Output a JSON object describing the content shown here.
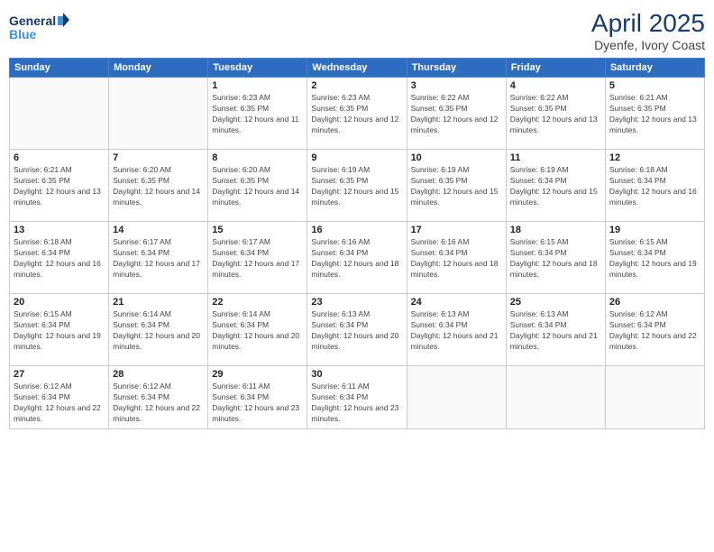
{
  "logo": {
    "line1": "General",
    "line2": "Blue"
  },
  "title": "April 2025",
  "subtitle": "Dyenfe, Ivory Coast",
  "days_of_week": [
    "Sunday",
    "Monday",
    "Tuesday",
    "Wednesday",
    "Thursday",
    "Friday",
    "Saturday"
  ],
  "weeks": [
    [
      {
        "day": "",
        "info": ""
      },
      {
        "day": "",
        "info": ""
      },
      {
        "day": "1",
        "info": "Sunrise: 6:23 AM\nSunset: 6:35 PM\nDaylight: 12 hours and 11 minutes."
      },
      {
        "day": "2",
        "info": "Sunrise: 6:23 AM\nSunset: 6:35 PM\nDaylight: 12 hours and 12 minutes."
      },
      {
        "day": "3",
        "info": "Sunrise: 6:22 AM\nSunset: 6:35 PM\nDaylight: 12 hours and 12 minutes."
      },
      {
        "day": "4",
        "info": "Sunrise: 6:22 AM\nSunset: 6:35 PM\nDaylight: 12 hours and 13 minutes."
      },
      {
        "day": "5",
        "info": "Sunrise: 6:21 AM\nSunset: 6:35 PM\nDaylight: 12 hours and 13 minutes."
      }
    ],
    [
      {
        "day": "6",
        "info": "Sunrise: 6:21 AM\nSunset: 6:35 PM\nDaylight: 12 hours and 13 minutes."
      },
      {
        "day": "7",
        "info": "Sunrise: 6:20 AM\nSunset: 6:35 PM\nDaylight: 12 hours and 14 minutes."
      },
      {
        "day": "8",
        "info": "Sunrise: 6:20 AM\nSunset: 6:35 PM\nDaylight: 12 hours and 14 minutes."
      },
      {
        "day": "9",
        "info": "Sunrise: 6:19 AM\nSunset: 6:35 PM\nDaylight: 12 hours and 15 minutes."
      },
      {
        "day": "10",
        "info": "Sunrise: 6:19 AM\nSunset: 6:35 PM\nDaylight: 12 hours and 15 minutes."
      },
      {
        "day": "11",
        "info": "Sunrise: 6:19 AM\nSunset: 6:34 PM\nDaylight: 12 hours and 15 minutes."
      },
      {
        "day": "12",
        "info": "Sunrise: 6:18 AM\nSunset: 6:34 PM\nDaylight: 12 hours and 16 minutes."
      }
    ],
    [
      {
        "day": "13",
        "info": "Sunrise: 6:18 AM\nSunset: 6:34 PM\nDaylight: 12 hours and 16 minutes."
      },
      {
        "day": "14",
        "info": "Sunrise: 6:17 AM\nSunset: 6:34 PM\nDaylight: 12 hours and 17 minutes."
      },
      {
        "day": "15",
        "info": "Sunrise: 6:17 AM\nSunset: 6:34 PM\nDaylight: 12 hours and 17 minutes."
      },
      {
        "day": "16",
        "info": "Sunrise: 6:16 AM\nSunset: 6:34 PM\nDaylight: 12 hours and 18 minutes."
      },
      {
        "day": "17",
        "info": "Sunrise: 6:16 AM\nSunset: 6:34 PM\nDaylight: 12 hours and 18 minutes."
      },
      {
        "day": "18",
        "info": "Sunrise: 6:15 AM\nSunset: 6:34 PM\nDaylight: 12 hours and 18 minutes."
      },
      {
        "day": "19",
        "info": "Sunrise: 6:15 AM\nSunset: 6:34 PM\nDaylight: 12 hours and 19 minutes."
      }
    ],
    [
      {
        "day": "20",
        "info": "Sunrise: 6:15 AM\nSunset: 6:34 PM\nDaylight: 12 hours and 19 minutes."
      },
      {
        "day": "21",
        "info": "Sunrise: 6:14 AM\nSunset: 6:34 PM\nDaylight: 12 hours and 20 minutes."
      },
      {
        "day": "22",
        "info": "Sunrise: 6:14 AM\nSunset: 6:34 PM\nDaylight: 12 hours and 20 minutes."
      },
      {
        "day": "23",
        "info": "Sunrise: 6:13 AM\nSunset: 6:34 PM\nDaylight: 12 hours and 20 minutes."
      },
      {
        "day": "24",
        "info": "Sunrise: 6:13 AM\nSunset: 6:34 PM\nDaylight: 12 hours and 21 minutes."
      },
      {
        "day": "25",
        "info": "Sunrise: 6:13 AM\nSunset: 6:34 PM\nDaylight: 12 hours and 21 minutes."
      },
      {
        "day": "26",
        "info": "Sunrise: 6:12 AM\nSunset: 6:34 PM\nDaylight: 12 hours and 22 minutes."
      }
    ],
    [
      {
        "day": "27",
        "info": "Sunrise: 6:12 AM\nSunset: 6:34 PM\nDaylight: 12 hours and 22 minutes."
      },
      {
        "day": "28",
        "info": "Sunrise: 6:12 AM\nSunset: 6:34 PM\nDaylight: 12 hours and 22 minutes."
      },
      {
        "day": "29",
        "info": "Sunrise: 6:11 AM\nSunset: 6:34 PM\nDaylight: 12 hours and 23 minutes."
      },
      {
        "day": "30",
        "info": "Sunrise: 6:11 AM\nSunset: 6:34 PM\nDaylight: 12 hours and 23 minutes."
      },
      {
        "day": "",
        "info": ""
      },
      {
        "day": "",
        "info": ""
      },
      {
        "day": "",
        "info": ""
      }
    ]
  ]
}
